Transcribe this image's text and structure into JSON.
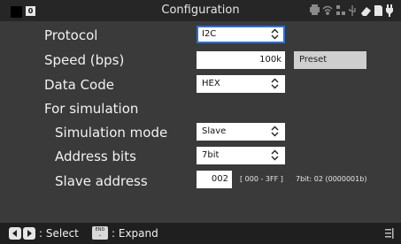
{
  "window": {
    "title": "Configuration",
    "indicator_label": "0"
  },
  "status_icons": [
    "print-icon",
    "wifi-icon",
    "network-icon",
    "usb-icon",
    "eraser-icon",
    "sd-card-icon",
    "plug-icon"
  ],
  "rows": {
    "protocol": {
      "label": "Protocol",
      "value": "I2C"
    },
    "speed": {
      "label": "Speed (bps)",
      "value": "100k",
      "button": "Preset"
    },
    "data_code": {
      "label": "Data Code",
      "value": "HEX"
    },
    "for_simulation": {
      "label": "For simulation"
    },
    "simulation_mode": {
      "label": "Simulation mode",
      "value": "Slave"
    },
    "address_bits": {
      "label": "Address bits",
      "value": "7bit"
    },
    "slave_address": {
      "label": "Slave address",
      "value": "002",
      "range": "[ 000 - 3FF ]",
      "bit_info": "7bit: 02 (0000001b)"
    }
  },
  "footer": {
    "select_label": ": Select",
    "end_key_label": "END",
    "expand_label": ": Expand"
  },
  "colors": {
    "focus_border": "#2a6fdb",
    "background": "#3a3a3a",
    "bar": "#262626"
  }
}
